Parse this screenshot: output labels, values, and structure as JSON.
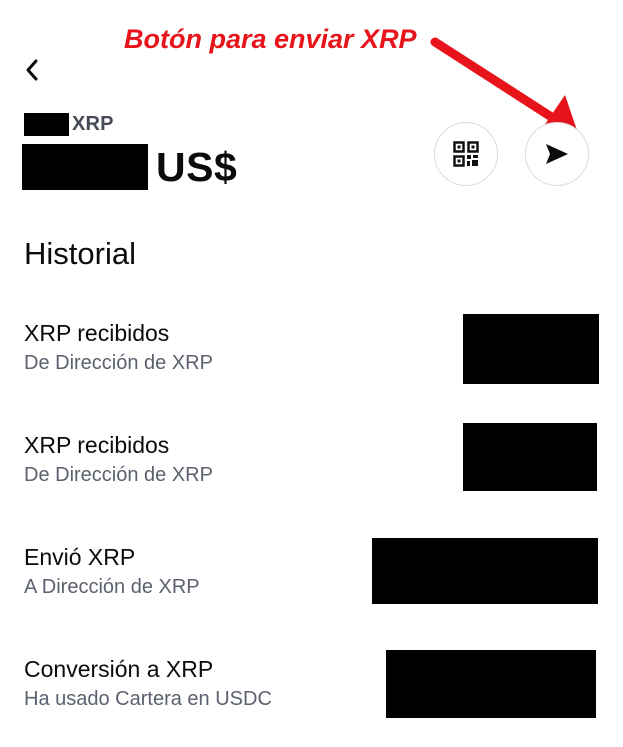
{
  "header": {
    "back_icon": "chevron-left-icon"
  },
  "annotation": {
    "text": "Botón para enviar XRP",
    "color": "#e8141b"
  },
  "asset": {
    "ticker": "XRP",
    "balance_currency": "US$"
  },
  "actions": {
    "qr_icon": "qr-code-icon",
    "send_icon": "send-icon"
  },
  "history": {
    "title": "Historial",
    "items": [
      {
        "title": "XRP recibidos",
        "subtitle": "De Dirección de XRP"
      },
      {
        "title": "XRP recibidos",
        "subtitle": "De Dirección de XRP"
      },
      {
        "title": "Envió XRP",
        "subtitle": "A Dirección de XRP"
      },
      {
        "title": "Conversión a XRP",
        "subtitle": "Ha usado Cartera en USDC"
      }
    ]
  }
}
